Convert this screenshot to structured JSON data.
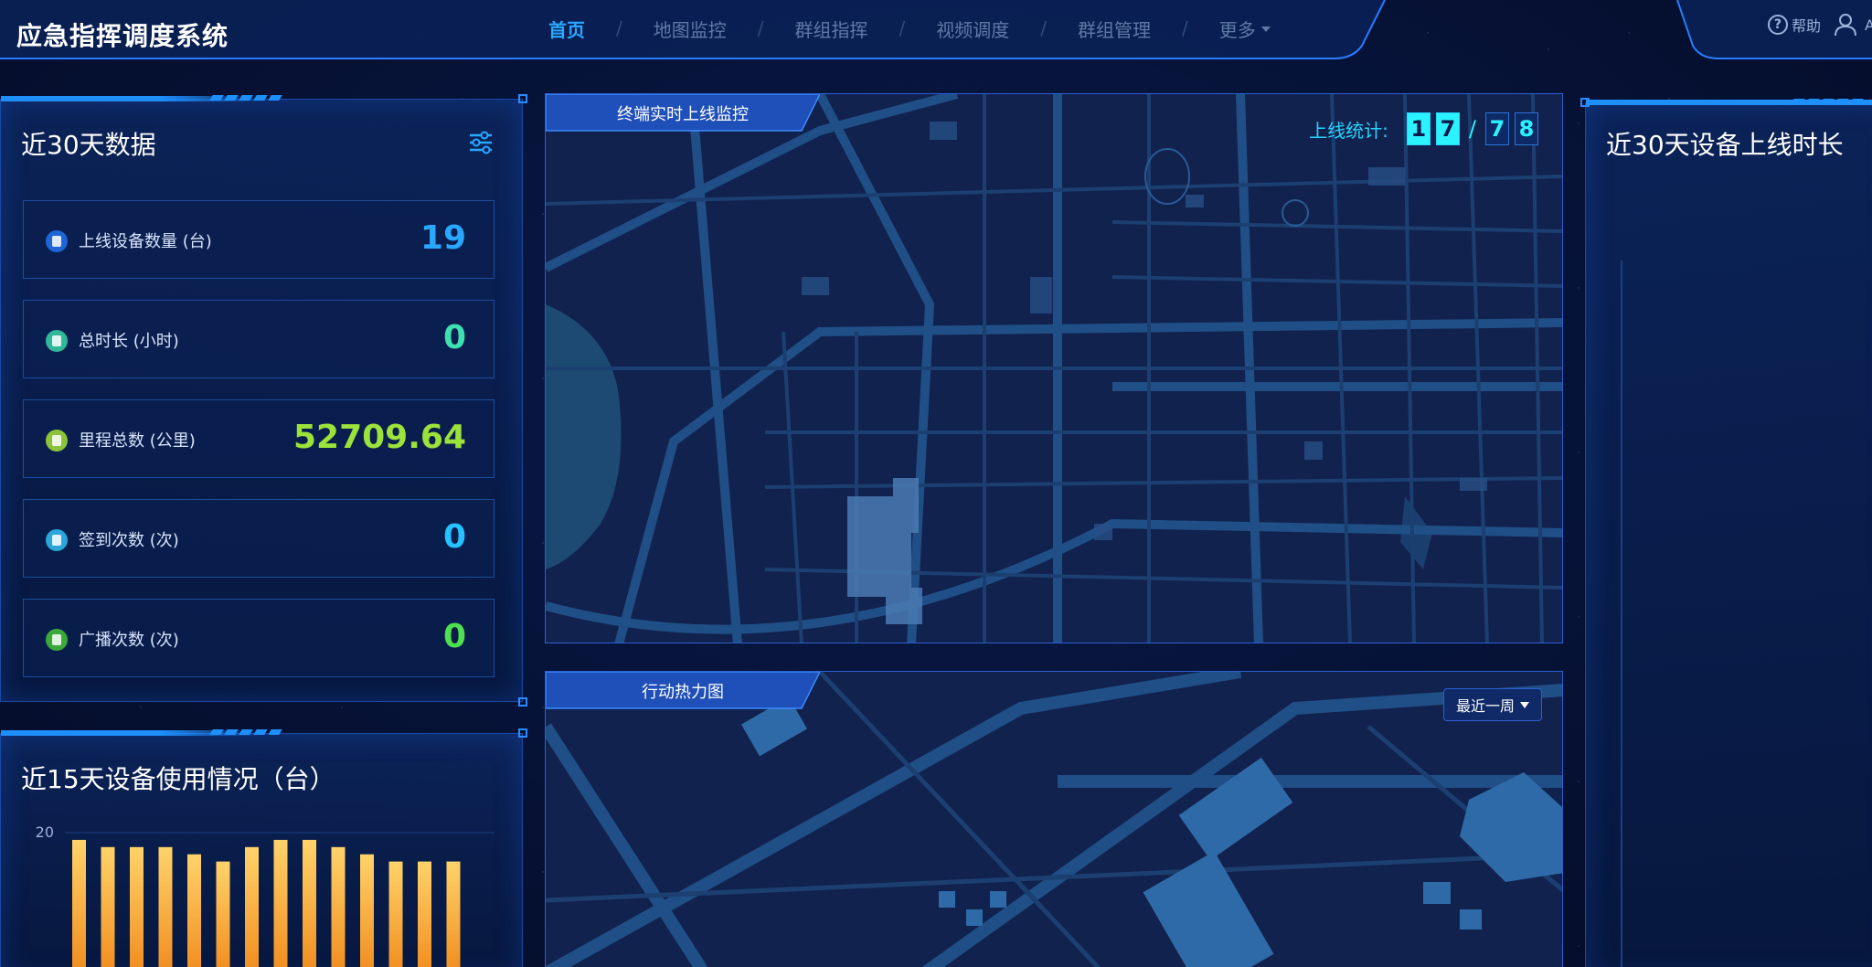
{
  "app": {
    "title": "应急指挥调度系统"
  },
  "nav": {
    "items": [
      {
        "label": "首页",
        "active": true
      },
      {
        "label": "地图监控",
        "active": false
      },
      {
        "label": "群组指挥",
        "active": false
      },
      {
        "label": "视频调度",
        "active": false
      },
      {
        "label": "群组管理",
        "active": false
      },
      {
        "label": "更多",
        "active": false,
        "has_dropdown": true
      }
    ]
  },
  "header_tools": {
    "help_label": "帮助",
    "user_label": "A"
  },
  "left_panel": {
    "title": "近30天数据",
    "stats": [
      {
        "label": "上线设备数量 (台)",
        "value": "19",
        "color": "#2aa7ff",
        "icon_color": "#1e66d6"
      },
      {
        "label": "总时长 (小时)",
        "value": "0",
        "color": "#3fe0b0",
        "icon_color": "#2fb89a"
      },
      {
        "label": "里程总数 (公里)",
        "value": "52709.64",
        "color": "#9be23a",
        "icon_color": "#8bc43a"
      },
      {
        "label": "签到次数 (次)",
        "value": "0",
        "color": "#25c2ff",
        "icon_color": "#2aa6d8"
      },
      {
        "label": "广播次数 (次)",
        "value": "0",
        "color": "#4ee04e",
        "icon_color": "#3aa83a"
      }
    ]
  },
  "usage_panel": {
    "title": "近15天设备使用情况（台）"
  },
  "chart_data": {
    "type": "bar",
    "title": "近15天设备使用情况（台）",
    "ylim": [
      0,
      20
    ],
    "yticks": [
      "20"
    ],
    "values": [
      19,
      18,
      18,
      18,
      17,
      16,
      18,
      19,
      19,
      18,
      17,
      16,
      16,
      16
    ],
    "colors": {
      "top": "#ffd36a",
      "bottom": "#f08a1c"
    }
  },
  "monitor_panel": {
    "tab_label": "终端实时上线监控",
    "online_label": "上线统计:",
    "online_digits": [
      "1",
      "7"
    ],
    "total_digits": [
      "7",
      "8"
    ],
    "separator": "/"
  },
  "heatmap_panel": {
    "tab_label": "行动热力图",
    "range_select": "最近一周"
  },
  "right_panel": {
    "title": "近30天设备上线时长"
  }
}
